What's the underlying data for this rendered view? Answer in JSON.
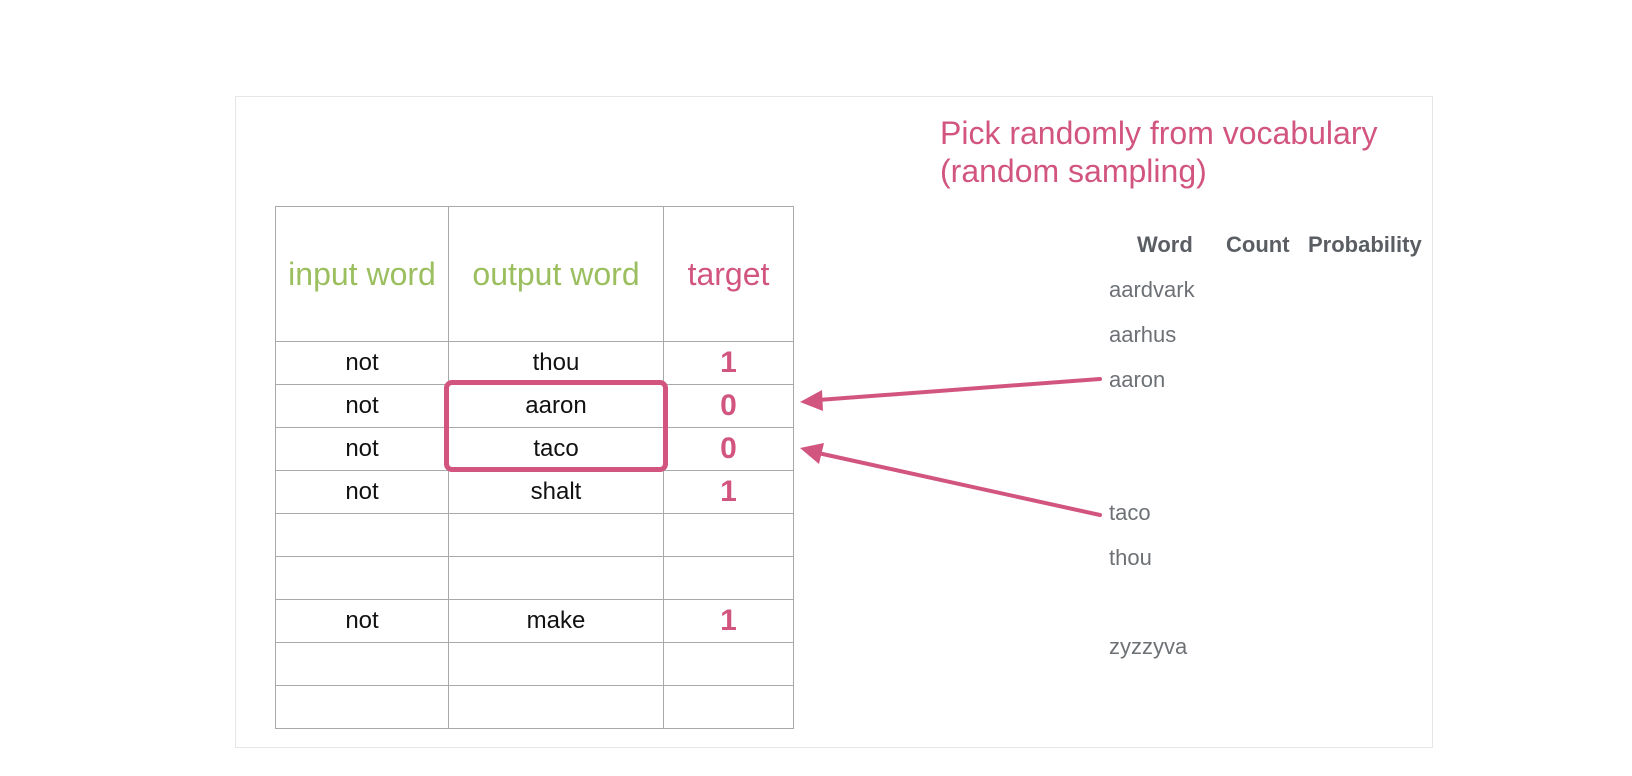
{
  "title": {
    "line1": "Pick randomly from vocabulary",
    "line2": "(random sampling)"
  },
  "table": {
    "headers": {
      "input": "input word",
      "output": "output word",
      "target": "target"
    },
    "rows": [
      {
        "input": "not",
        "output": "thou",
        "target": "1"
      },
      {
        "input": "not",
        "output": "aaron",
        "target": "0"
      },
      {
        "input": "not",
        "output": "taco",
        "target": "0"
      },
      {
        "input": "not",
        "output": "shalt",
        "target": "1"
      },
      {
        "input": "",
        "output": "",
        "target": ""
      },
      {
        "input": "",
        "output": "",
        "target": ""
      },
      {
        "input": "not",
        "output": "make",
        "target": "1"
      },
      {
        "input": "",
        "output": "",
        "target": ""
      },
      {
        "input": "",
        "output": "",
        "target": ""
      }
    ]
  },
  "vocabulary": {
    "headers": {
      "word": "Word",
      "count": "Count",
      "probability": "Probability"
    },
    "words": [
      "aardvark",
      "aarhus",
      "aaron",
      "taco",
      "thou",
      "zyzzyva"
    ]
  },
  "colors": {
    "accent_pink": "#d2557f",
    "header_green": "#9bbf5f",
    "vocab_text": "#6d7176"
  }
}
